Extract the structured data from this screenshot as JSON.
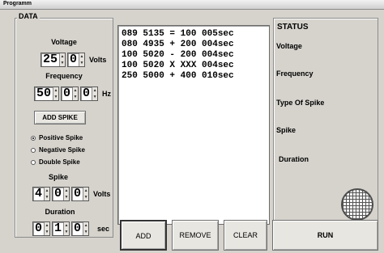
{
  "window": {
    "title": "Programm"
  },
  "data_panel": {
    "title": "DATA",
    "voltage": {
      "label": "Voltage",
      "digits": [
        "25",
        "0"
      ],
      "unit": "Volts"
    },
    "frequency": {
      "label": "Frequency",
      "digits": [
        "50",
        "0",
        "0"
      ],
      "unit": "Hz"
    },
    "add_spike_label": "ADD SPIKE",
    "spike_types": [
      {
        "label": "Positive Spike",
        "selected": true
      },
      {
        "label": "Negative Spike",
        "selected": false
      },
      {
        "label": "Double Spike",
        "selected": false
      }
    ],
    "spike": {
      "label": "Spike",
      "digits": [
        "4",
        "0",
        "0"
      ],
      "unit": "Volts"
    },
    "duration": {
      "label": "Duration",
      "digits": [
        "0",
        "1",
        "0"
      ],
      "unit": "sec"
    }
  },
  "program_list": {
    "lines": [
      "089 5135 = 100 005sec",
      "080 4935 + 200 004sec",
      "100 5020 - 200 004sec",
      "100 5020 X XXX 004sec",
      "250 5000 + 400 010sec"
    ]
  },
  "status_panel": {
    "title": "STATUS",
    "labels": [
      "Voltage",
      "Frequency",
      "Type Of Spike",
      "Spike",
      "Duration"
    ]
  },
  "buttons": {
    "add": "ADD",
    "remove": "REMOVE",
    "clear": "CLEAR",
    "run": "RUN"
  },
  "icons": {
    "arrow_up": "up-arrow-icon",
    "arrow_down": "down-arrow-icon",
    "status_ball": "grid-ball-icon"
  }
}
